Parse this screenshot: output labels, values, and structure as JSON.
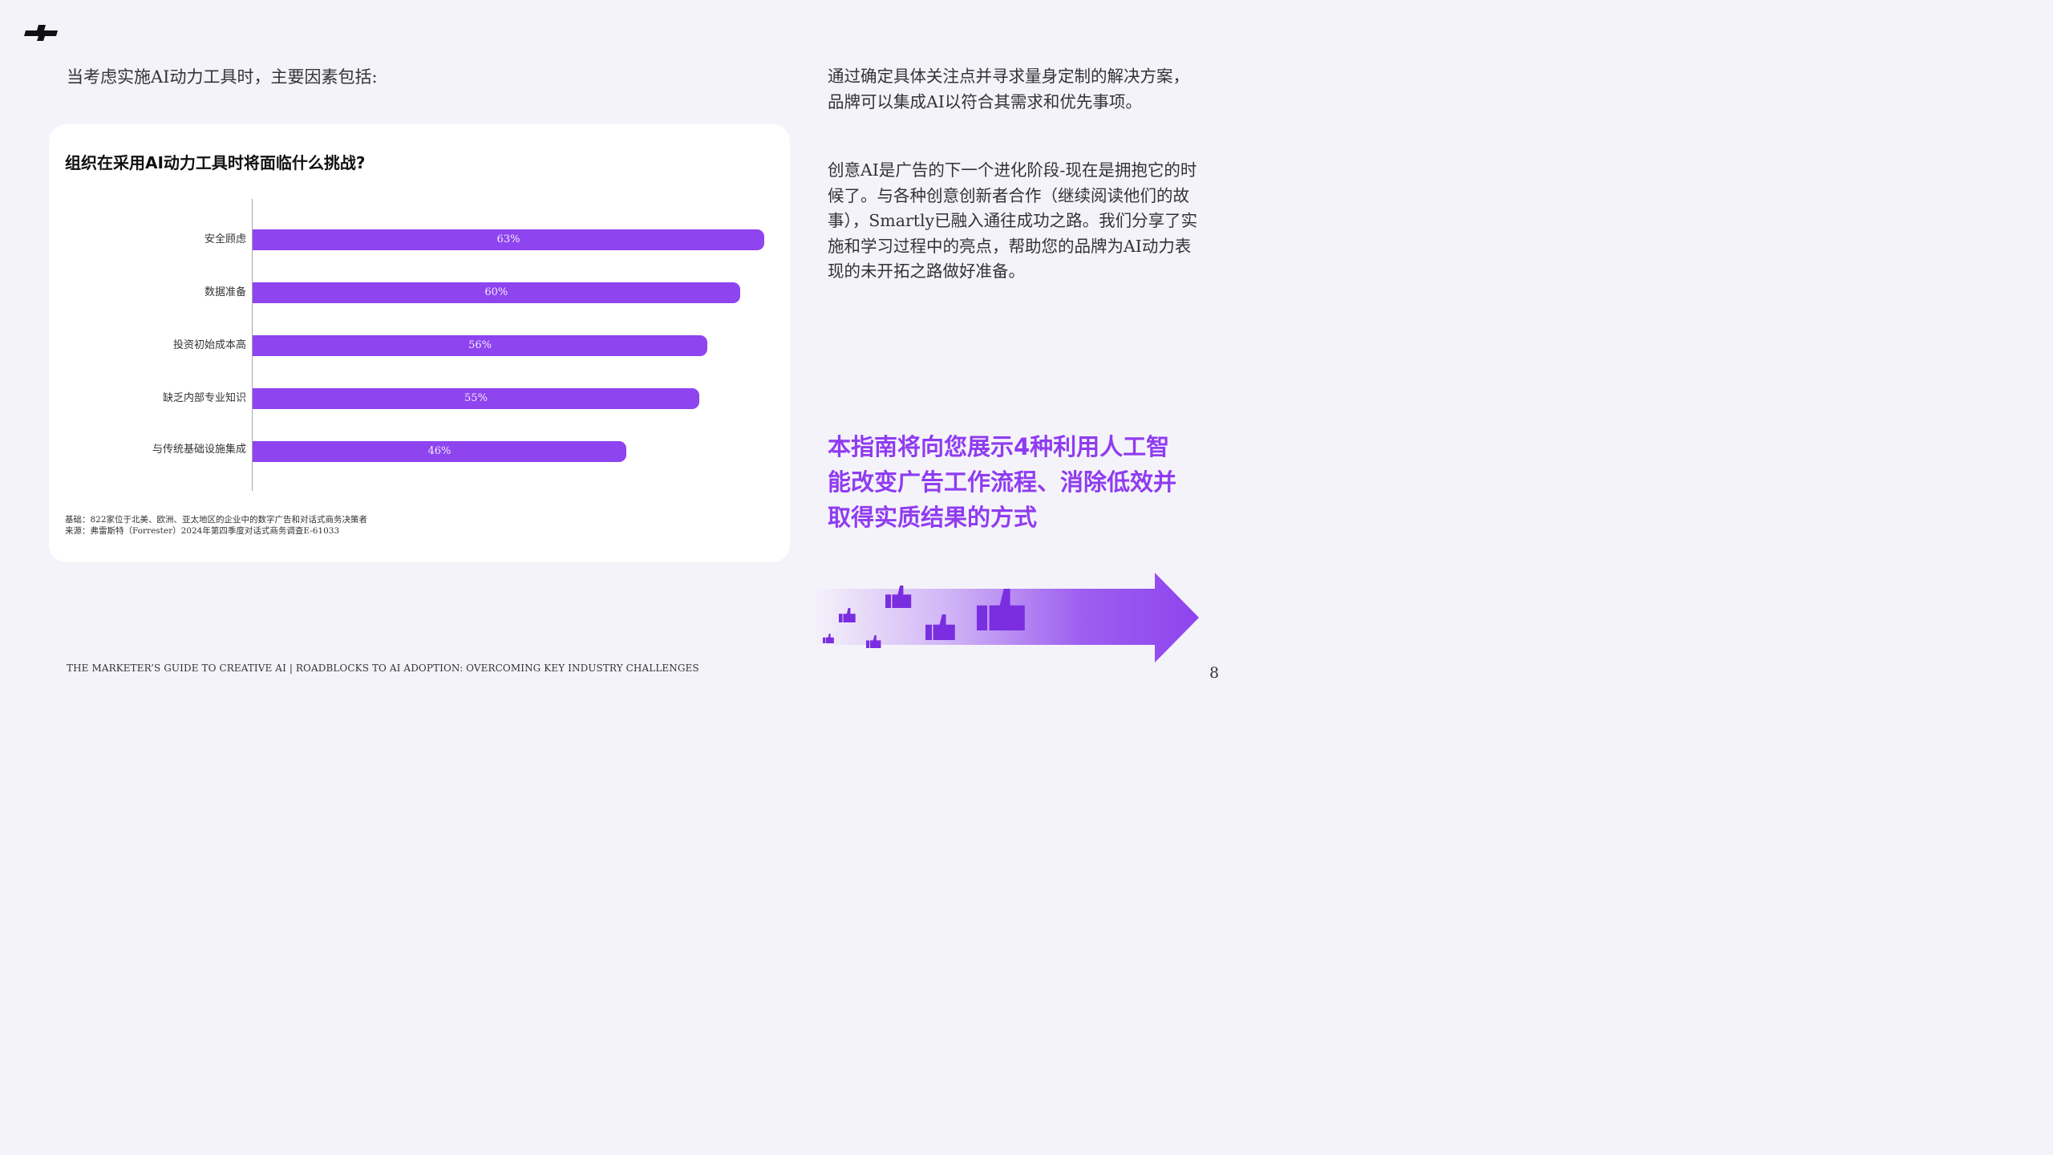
{
  "intro": "当考虑实施AI动力工具时，主要因素包括:",
  "chart_data": {
    "type": "bar",
    "orientation": "horizontal",
    "title": "组织在采用AI动力工具时将面临什么挑战?",
    "categories": [
      "安全顾虑",
      "数据准备",
      "投资初始成本高",
      "缺乏内部专业知识",
      "与传统基础设施集成"
    ],
    "values": [
      63,
      60,
      56,
      55,
      46
    ],
    "value_labels": [
      "63%",
      "60%",
      "56%",
      "55%",
      "46%"
    ],
    "unit": "%",
    "xlim": [
      0,
      63
    ],
    "grid": false,
    "bar_color": "#8e44ee"
  },
  "footnote": {
    "base": "基础：822家位于北美、欧洲、亚太地区的企业中的数字广告和对话式商务决策者",
    "source": "来源：弗雷斯特（Forrester）2024年第四季度对话式商务调查E-61033"
  },
  "right": {
    "para1": "通过确定具体关注点并寻求量身定制的解决方案，品牌可以集成AI以符合其需求和优先事项。",
    "para2": "创意AI是广告的下一个进化阶段-现在是拥抱它的时候了。与各种创意创新者合作（继续阅读他们的故事），Smartly已融入通往成功之路。我们分享了实施和学习过程中的亮点，帮助您的品牌为AI动力表现的未开拓之路做好准备。",
    "headline": "本指南将向您展示4种利用人工智能改变广告工作流程、消除低效并取得实质结果的方式"
  },
  "footer": "THE MARKETER’S GUIDE TO CREATIVE AI | ROADBLOCKS TO AI ADOPTION: OVERCOMING KEY INDUSTRY CHALLENGES",
  "page_number": "8",
  "icons": [
    "brand-logo-icon",
    "thumbs-up-icon",
    "arrow-right-icon"
  ],
  "colors": {
    "accent": "#8f3cf0",
    "bar": "#8e44ee",
    "background": "#f5f3fa",
    "card": "#ffffff"
  }
}
